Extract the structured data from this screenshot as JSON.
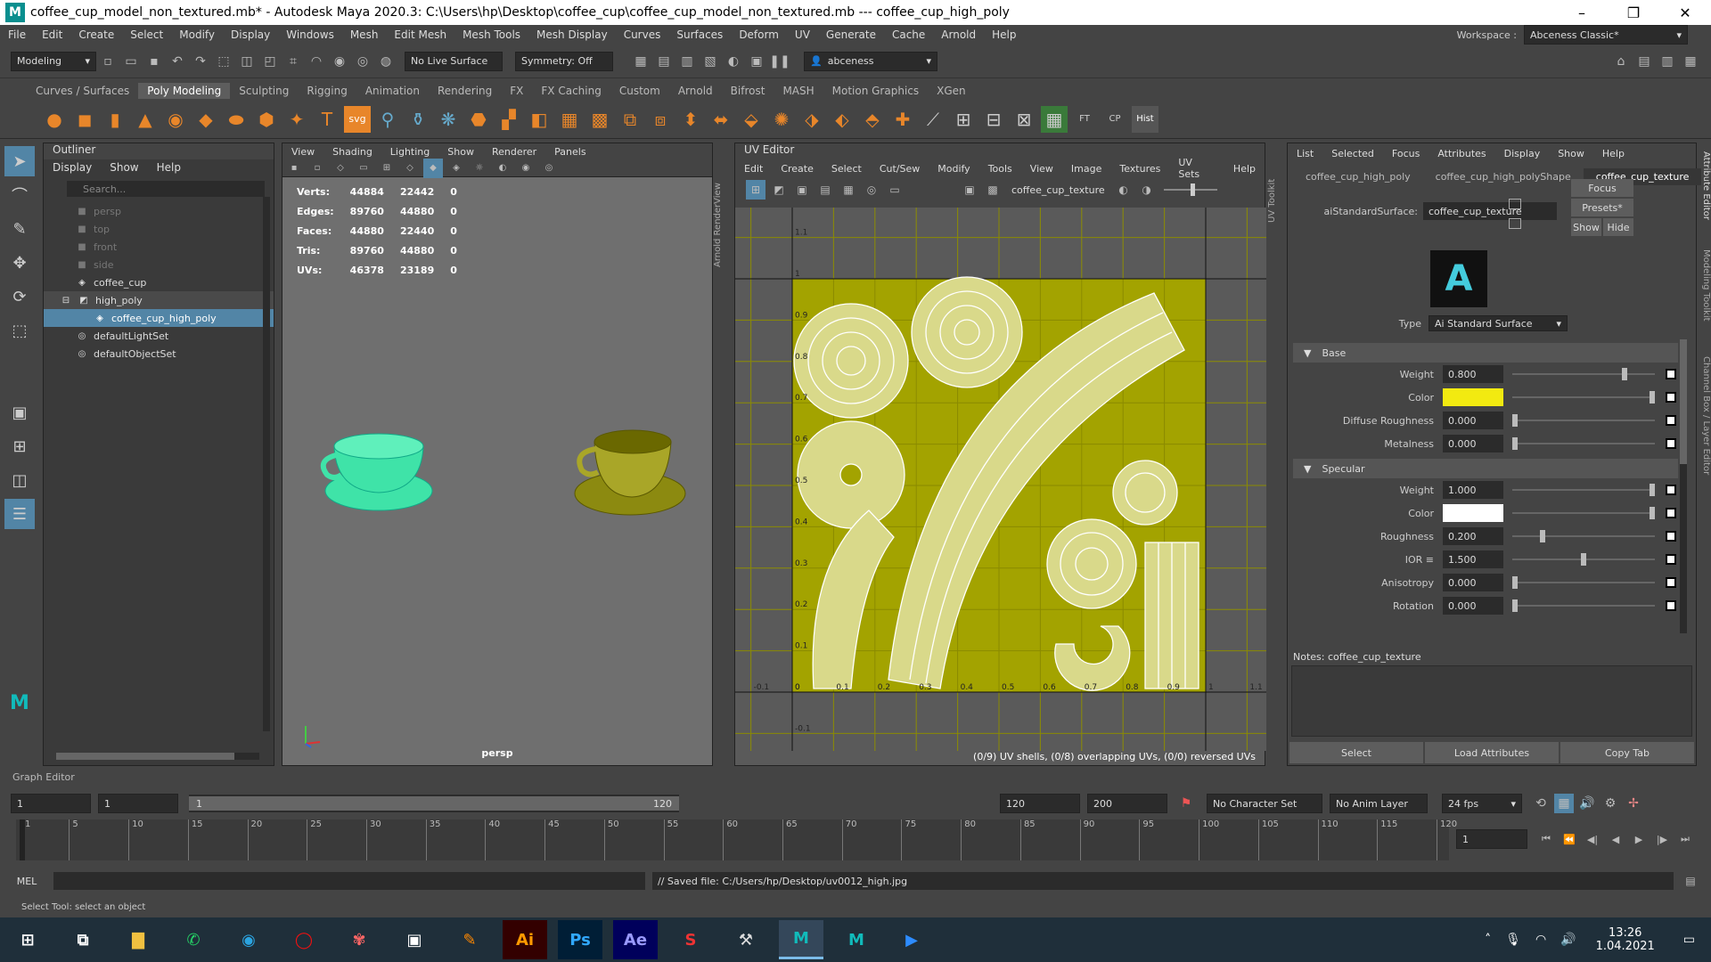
{
  "window": {
    "title": "coffee_cup_model_non_textured.mb* - Autodesk Maya 2020.3: C:\\Users\\hp\\Desktop\\coffee_cup\\coffee_cup_model_non_textured.mb   ---   coffee_cup_high_poly"
  },
  "menubar": [
    "File",
    "Edit",
    "Create",
    "Select",
    "Modify",
    "Display",
    "Windows",
    "Mesh",
    "Edit Mesh",
    "Mesh Tools",
    "Mesh Display",
    "Curves",
    "Surfaces",
    "Deform",
    "UV",
    "Generate",
    "Cache",
    "Arnold",
    "Help"
  ],
  "workspace": {
    "label": "Workspace :",
    "value": "Abceness Classic*"
  },
  "status": {
    "menuset": "Modeling",
    "live_surface": "No Live Surface",
    "symmetry": "Symmetry: Off",
    "user": "abceness"
  },
  "shelf_tabs": [
    "Curves / Surfaces",
    "Poly Modeling",
    "Sculpting",
    "Rigging",
    "Animation",
    "Rendering",
    "FX",
    "FX Caching",
    "Custom",
    "Arnold",
    "Bifrost",
    "MASH",
    "Motion Graphics",
    "XGen"
  ],
  "shelf_tail": [
    "FT",
    "CP",
    "Hist"
  ],
  "outliner": {
    "title": "Outliner",
    "menu": [
      "Display",
      "Show",
      "Help"
    ],
    "search_placeholder": "Search...",
    "items": [
      {
        "label": "persp",
        "dim": true
      },
      {
        "label": "top",
        "dim": true
      },
      {
        "label": "front",
        "dim": true
      },
      {
        "label": "side",
        "dim": true
      },
      {
        "label": "coffee_cup"
      },
      {
        "label": "high_poly"
      },
      {
        "label": "coffee_cup_high_poly",
        "selected": true
      },
      {
        "label": "defaultLightSet"
      },
      {
        "label": "defaultObjectSet"
      }
    ]
  },
  "viewport": {
    "menu": [
      "View",
      "Shading",
      "Lighting",
      "Show",
      "Renderer",
      "Panels"
    ],
    "camera": "persp",
    "hud": [
      {
        "k": "Verts:",
        "a": "44884",
        "b": "22442",
        "c": "0"
      },
      {
        "k": "Edges:",
        "a": "89760",
        "b": "44880",
        "c": "0"
      },
      {
        "k": "Faces:",
        "a": "44880",
        "b": "22440",
        "c": "0"
      },
      {
        "k": "Tris:",
        "a": "89760",
        "b": "44880",
        "c": "0"
      },
      {
        "k": "UVs:",
        "a": "46378",
        "b": "23189",
        "c": "0"
      }
    ],
    "side_label": "Arnold RenderView"
  },
  "uv_editor": {
    "title": "UV Editor",
    "menu": [
      "Edit",
      "Create",
      "Select",
      "Cut/Sew",
      "Modify",
      "Tools",
      "View",
      "Image",
      "Textures",
      "UV Sets",
      "Help"
    ],
    "texture": "coffee_cup_texture",
    "status": "(0/9) UV shells, (0/8) overlapping UVs, (0/0) reversed UVs",
    "side_label": "UV Toolkit",
    "axis_x": [
      "-0.1",
      "0",
      "0.1",
      "0.2",
      "0.3",
      "0.4",
      "0.5",
      "0.6",
      "0.7",
      "0.8",
      "0.9",
      "1",
      "1.1"
    ],
    "axis_y": [
      "1.1",
      "1",
      "0.9",
      "0.8",
      "0.7",
      "0.6",
      "0.5",
      "0.4",
      "0.3",
      "0.2",
      "0.1",
      "0",
      "-0.1"
    ]
  },
  "attr_editor": {
    "menu": [
      "List",
      "Selected",
      "Focus",
      "Attributes",
      "Display",
      "Show",
      "Help"
    ],
    "tabs": [
      "coffee_cup_high_poly",
      "coffee_cup_high_polyShape",
      "coffee_cup_texture"
    ],
    "node_label": "aiStandardSurface:",
    "node_value": "coffee_cup_texture",
    "buttons": [
      "Focus",
      "Presets*",
      "Show",
      "Hide"
    ],
    "type_label": "Type",
    "type_value": "Ai Standard Surface",
    "base": {
      "title": "Base",
      "rows": [
        {
          "label": "Weight",
          "value": "0.800",
          "pos": 0.8
        },
        {
          "label": "Color",
          "color": "#f2ea10",
          "pos": 1.0
        },
        {
          "label": "Diffuse Roughness",
          "value": "0.000",
          "pos": 0
        },
        {
          "label": "Metalness",
          "value": "0.000",
          "pos": 0
        }
      ]
    },
    "specular": {
      "title": "Specular",
      "rows": [
        {
          "label": "Weight",
          "value": "1.000",
          "pos": 1.0
        },
        {
          "label": "Color",
          "color": "#ffffff",
          "pos": 1.0
        },
        {
          "label": "Roughness",
          "value": "0.200",
          "pos": 0.2
        },
        {
          "label": "IOR ≡",
          "value": "1.500",
          "pos": 0.5
        },
        {
          "label": "Anisotropy",
          "value": "0.000",
          "pos": 0
        },
        {
          "label": "Rotation",
          "value": "0.000",
          "pos": 0
        }
      ]
    },
    "notes": "Notes:  coffee_cup_texture",
    "bottom": [
      "Select",
      "Load Attributes",
      "Copy Tab"
    ],
    "side_labels": [
      "Attribute Editor",
      "Modeling Toolkit",
      "Channel Box / Layer Editor"
    ]
  },
  "graph_editor": "Graph Editor",
  "timeline": {
    "start": "1",
    "cur": "1",
    "range_start": "1",
    "range_end": "120",
    "end": "120",
    "anim_end": "200",
    "ticks": [
      "1",
      "5",
      "10",
      "15",
      "20",
      "25",
      "30",
      "35",
      "40",
      "45",
      "50",
      "55",
      "60",
      "65",
      "70",
      "75",
      "80",
      "85",
      "90",
      "95",
      "100",
      "105",
      "110",
      "115",
      "120"
    ],
    "frame": "1",
    "char_set": "No Character Set",
    "anim_layer": "No Anim Layer",
    "fps": "24 fps"
  },
  "command": {
    "lang": "MEL",
    "result": "// Saved file: C:/Users/hp/Desktop/uv0012_high.jpg"
  },
  "help_line": "Select Tool: select an object",
  "taskbar": {
    "apps": [
      "Ai",
      "Ps",
      "Ae",
      "M",
      "M"
    ],
    "time": "13:26",
    "date": "1.04.2021"
  },
  "colors": {
    "uv_bg": "#a3a300",
    "wire": "#ffffff",
    "cup_sel": "#3fe3a8",
    "cup_tex": "#8c8a10",
    "accent": "#5285a6"
  }
}
